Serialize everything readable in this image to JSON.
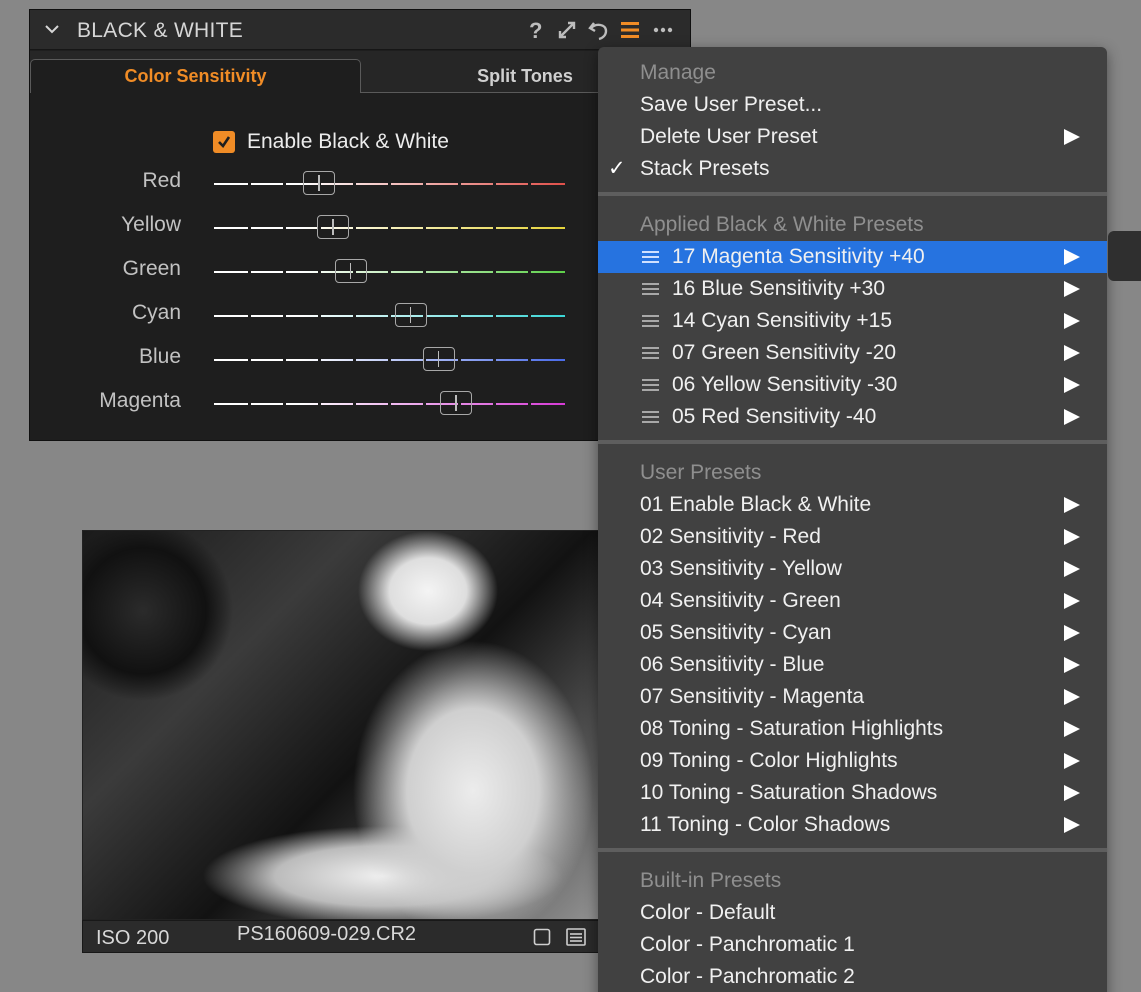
{
  "panel": {
    "title": "BLACK & WHITE",
    "icons": [
      "chevron-down-icon",
      "help-icon",
      "resize-icon",
      "reset-icon",
      "presets-menu-icon",
      "more-icon"
    ],
    "accent_color": "#f08c26",
    "tabs": [
      {
        "label": "Color Sensitivity",
        "active": true
      },
      {
        "label": "Split Tones",
        "active": false
      }
    ],
    "enable_label": "Enable Black & White",
    "enable_checked": true,
    "sliders": [
      {
        "label": "Red",
        "color": "#e0504a",
        "value": 0.3
      },
      {
        "label": "Yellow",
        "color": "#e6d43a",
        "value": 0.34
      },
      {
        "label": "Green",
        "color": "#5ed04a",
        "value": 0.39
      },
      {
        "label": "Cyan",
        "color": "#3ad6d6",
        "value": 0.56
      },
      {
        "label": "Blue",
        "color": "#4a6be8",
        "value": 0.64
      },
      {
        "label": "Magenta",
        "color": "#d63ad6",
        "value": 0.69
      }
    ]
  },
  "photo": {
    "iso": "ISO 200",
    "filename": "PS160609-029.CR2"
  },
  "menu": {
    "manage_header": "Manage",
    "save_user_preset": "Save User Preset...",
    "delete_user_preset": "Delete User Preset",
    "stack_presets": "Stack Presets",
    "stack_presets_checked": true,
    "applied_header": "Applied Black & White Presets",
    "applied": [
      "17 Magenta Sensitivity +40",
      "16 Blue Sensitivity +30",
      "14 Cyan Sensitivity +15",
      "07 Green Sensitivity -20",
      "06 Yellow Sensitivity -30",
      "05 Red Sensitivity -40"
    ],
    "selected_color": "#2673e0",
    "user_header": "User Presets",
    "user": [
      "01 Enable Black & White",
      "02 Sensitivity - Red",
      "03 Sensitivity - Yellow",
      "04 Sensitivity - Green",
      "05 Sensitivity - Cyan",
      "06 Sensitivity - Blue",
      "07 Sensitivity - Magenta",
      "08 Toning - Saturation Highlights",
      "09 Toning - Color Highlights",
      "10 Toning - Saturation Shadows",
      "11 Toning - Color Shadows"
    ],
    "builtin_header": "Built-in Presets",
    "builtin": [
      "Color - Default",
      "Color - Panchromatic 1",
      "Color - Panchromatic 2"
    ]
  }
}
